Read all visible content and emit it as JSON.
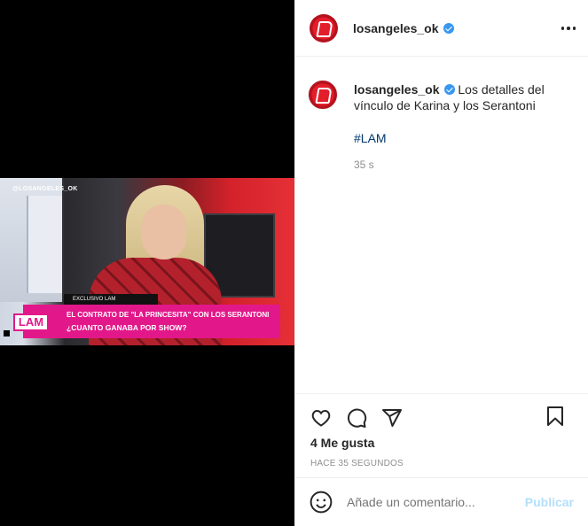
{
  "video": {
    "watermark": "@LOSANGELES_OK",
    "exclusive": "EXCLUSIVO LAM",
    "logo": "LAM",
    "line1": "EL CONTRATO DE \"LA PRINCESITA\" CON LOS SERANTONI",
    "line2": "¿CUANTO GANABA POR SHOW?"
  },
  "header": {
    "username": "losangeles_ok",
    "verified": true,
    "more_icon": "more-options-icon"
  },
  "caption": {
    "username": "losangeles_ok",
    "text": " Los detalles del vínculo de Karina y los Serantoni",
    "hashtag": "#LAM",
    "age": "35 s"
  },
  "actions": {
    "like_icon": "heart-icon",
    "comment_icon": "comment-icon",
    "share_icon": "share-icon",
    "save_icon": "bookmark-icon",
    "likes": "4 Me gusta",
    "time": "HACE 35 SEGUNDOS"
  },
  "add_comment": {
    "placeholder": "Añade un comentario...",
    "post_label": "Publicar"
  },
  "colors": {
    "link": "#00376b",
    "verified": "#3897f0",
    "post_disabled": "#b2dffc",
    "brand_pink": "#e2188a",
    "brand_red": "#e31e2b"
  }
}
